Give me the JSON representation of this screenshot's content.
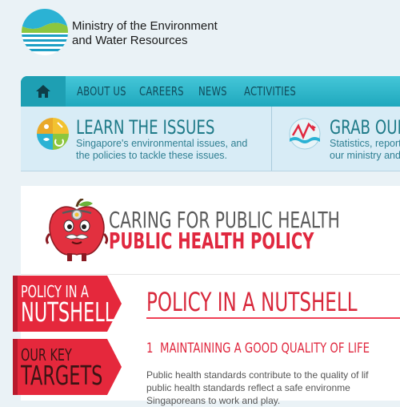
{
  "header": {
    "org_line1": "Ministry of the Environment",
    "org_line2": "and Water Resources"
  },
  "nav": {
    "home_icon": "home-icon",
    "items": [
      "ABOUT US",
      "CAREERS",
      "NEWS",
      "ACTIVITIES"
    ]
  },
  "promo": {
    "learn": {
      "title": "LEARN THE ISSUES",
      "desc_line1": "Singapore's environmental issues, and",
      "desc_line2": "the policies to tackle these issues.",
      "icon": "issues-pie-icon"
    },
    "grab": {
      "title": "GRAB OUR",
      "desc_line1": "Statistics, report",
      "desc_line2": "our ministry and",
      "icon": "chart-wave-icon"
    }
  },
  "page": {
    "subtitle": "CARING FOR PUBLIC HEALTH",
    "title": "PUBLIC HEALTH POLICY",
    "mascot": "apple-doctor-mascot"
  },
  "side_tabs": [
    {
      "line1": "POLICY IN A",
      "line2": "NUTSHELL"
    },
    {
      "line1": "OUR KEY",
      "line2": "TARGETS"
    }
  ],
  "section": {
    "title": "POLICY IN A NUTSHELL",
    "item_number": "1",
    "item_title": "MAINTAINING A GOOD QUALITY OF LIFE",
    "para_line1": "Public health standards contribute to the quality of lif",
    "para_line2": "public health standards reflect a safe environme",
    "para_line3": "Singaporeans to work and play."
  },
  "colors": {
    "accent_red": "#e0283f",
    "nav_teal": "#1fa8bd",
    "promo_bg": "#d8ecf6"
  }
}
